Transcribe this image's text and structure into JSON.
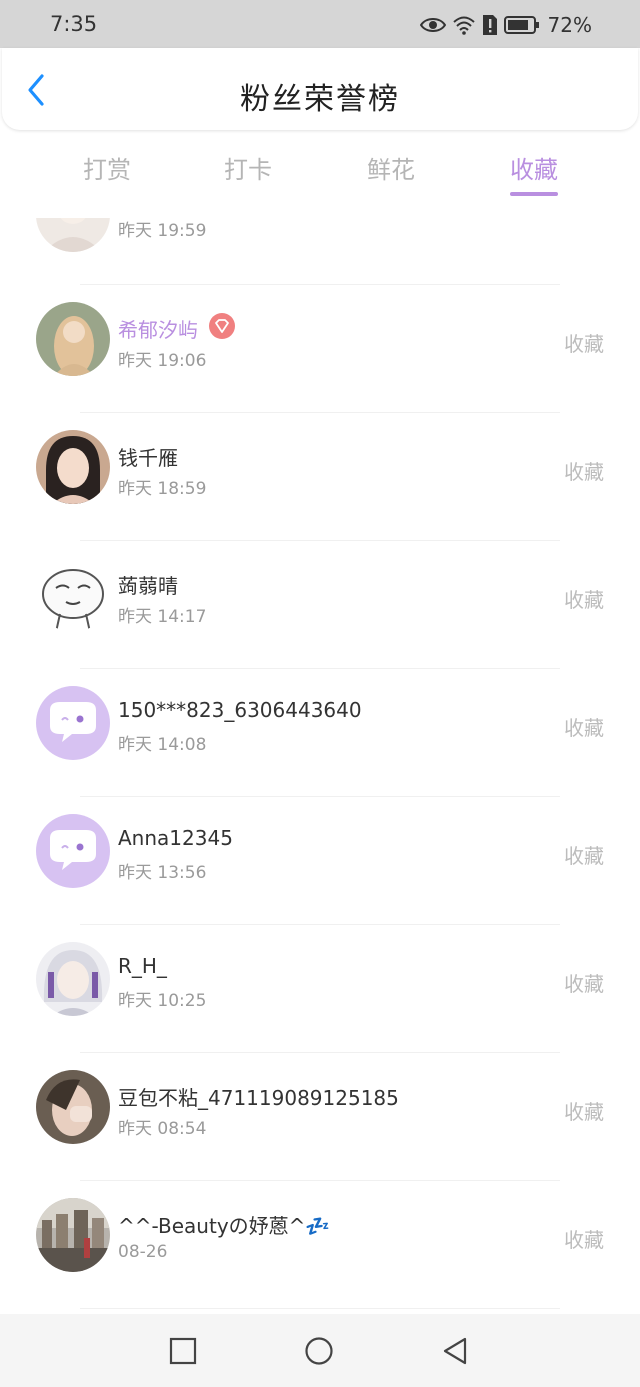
{
  "status": {
    "time": "7:35",
    "battery": "72%"
  },
  "header": {
    "title": "粉丝荣誉榜"
  },
  "tabs": [
    {
      "label": "打赏"
    },
    {
      "label": "打卡"
    },
    {
      "label": "鲜花"
    },
    {
      "label": "收藏"
    }
  ],
  "active_tab": "收藏",
  "list": [
    {
      "name": "",
      "time": "昨天 19:59",
      "action": ""
    },
    {
      "name": "希郁汐屿",
      "time": "昨天 19:06",
      "action": "收藏"
    },
    {
      "name": "钱千雁",
      "time": "昨天 18:59",
      "action": "收藏"
    },
    {
      "name": "蒟蒻晴",
      "time": "昨天 14:17",
      "action": "收藏"
    },
    {
      "name": "150***823_6306443640",
      "time": "昨天 14:08",
      "action": "收藏"
    },
    {
      "name": "Anna12345",
      "time": "昨天 13:56",
      "action": "收藏"
    },
    {
      "name": "R_H_",
      "time": "昨天 10:25",
      "action": "收藏"
    },
    {
      "name": "豆包不粘_471119089125185",
      "time": "昨天 08:54",
      "action": "收藏"
    },
    {
      "name": "^^-Beautyの妤蒽^💤",
      "time": "08-26",
      "action": "收藏"
    }
  ],
  "colors": {
    "accent": "#b98fe0",
    "back": "#1e90ff",
    "badge": "#f08080"
  }
}
